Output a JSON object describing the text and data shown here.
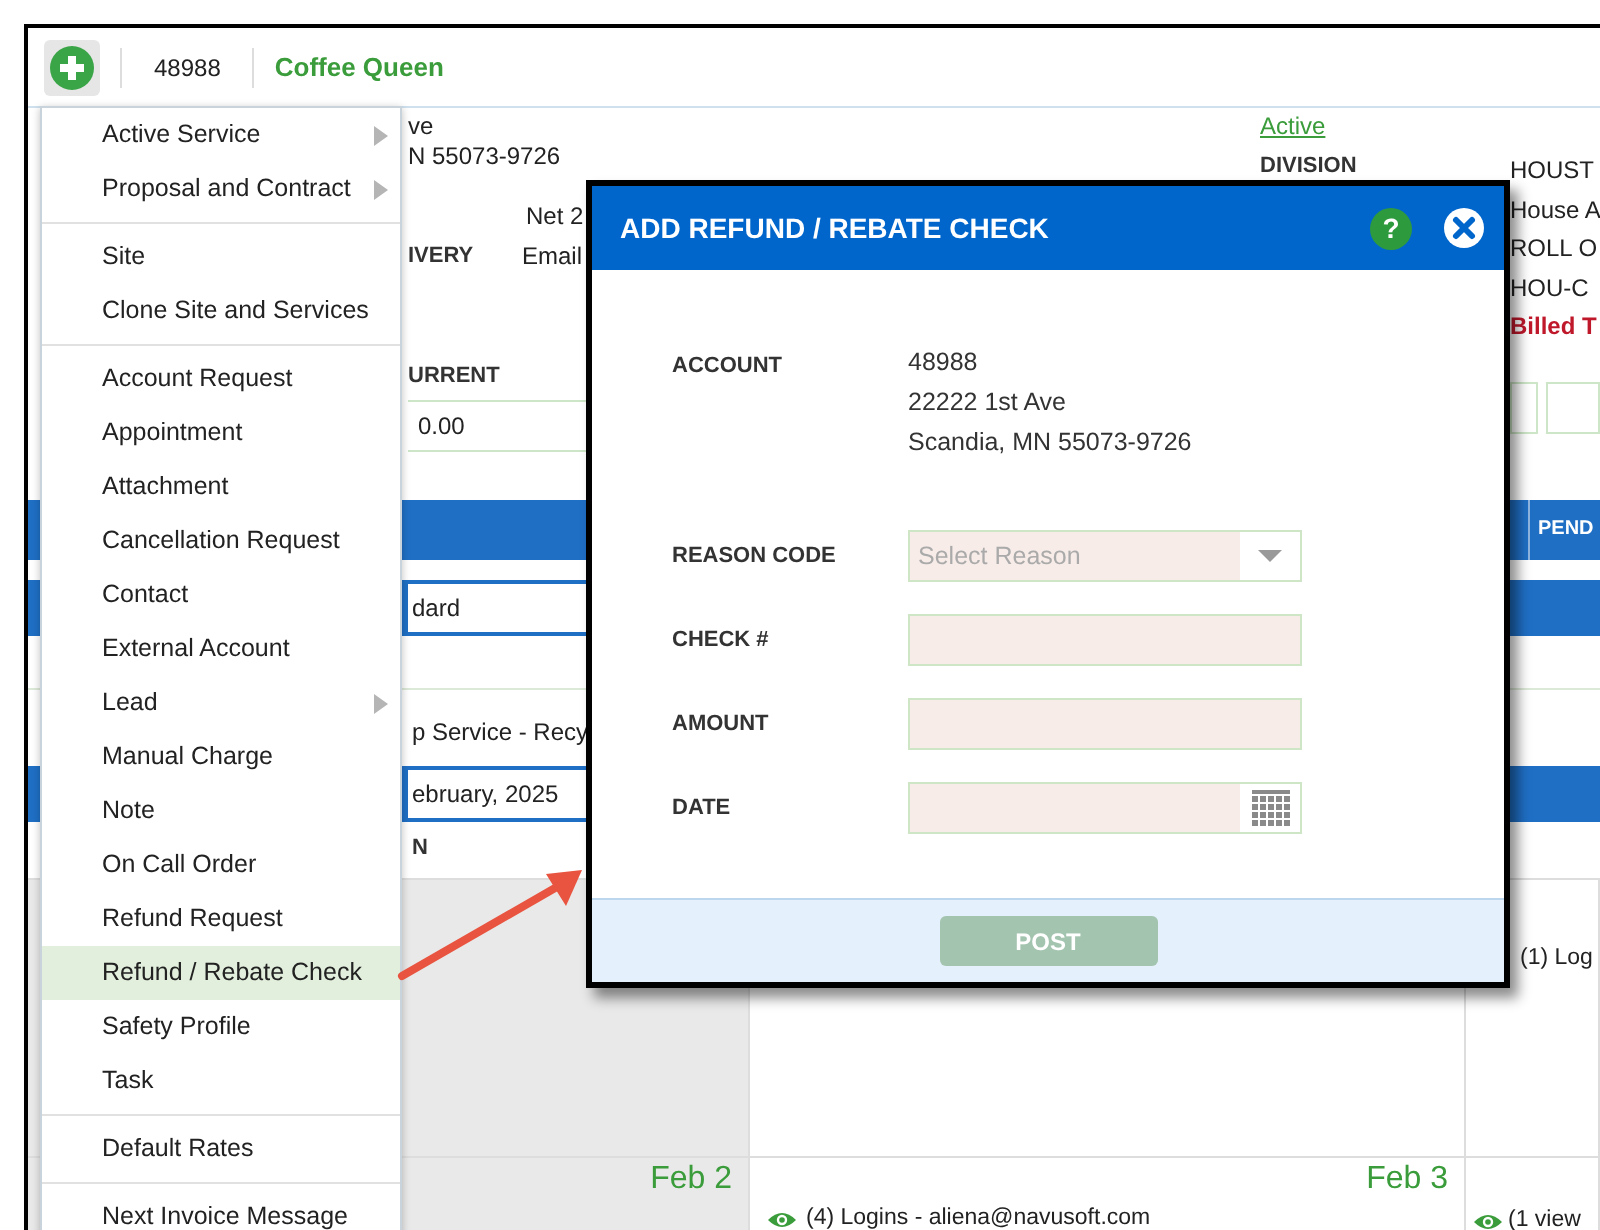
{
  "header": {
    "account_number": "48988",
    "customer_name": "Coffee Queen"
  },
  "account_summary": {
    "address_lines": [
      "ve",
      "N 55073-9726"
    ],
    "terms": "Net 2",
    "delivery": {
      "label": "IVERY",
      "value": "Email"
    },
    "balance": {
      "label": "URRENT",
      "value": "0.00"
    },
    "status": "Active",
    "division": {
      "label": "DIVISION",
      "values": [
        "HOUST",
        "House A",
        "ROLL O",
        "HOU-C"
      ]
    },
    "billing_notice": "Billed T"
  },
  "services_header": {
    "column_label": "PEND"
  },
  "service_rows": [
    {
      "kind": "blue-field",
      "value": "dard"
    },
    {
      "kind": "blank"
    },
    {
      "kind": "text",
      "value": "p Service - Recy"
    },
    {
      "kind": "blue-field",
      "value": "ebruary, 2025"
    },
    {
      "kind": "label",
      "value": "N"
    }
  ],
  "calendar": {
    "weeks": [
      {
        "days": [
          {
            "weekend": true
          },
          {
            "weekend": false
          },
          {
            "weekend": false,
            "events": [
              {
                "text": "(1) Log",
                "eye_icon": false
              }
            ]
          }
        ]
      },
      {
        "days": [
          {
            "date": "Feb 2",
            "weekend": true
          },
          {
            "date": "Feb 3",
            "weekend": false,
            "events": [
              {
                "text": "(4) Logins - aliena@navusoft.com",
                "eye_icon": true
              }
            ]
          },
          {
            "weekend": false,
            "events": [
              {
                "text": "(1 view",
                "eye_icon": true
              }
            ]
          }
        ]
      }
    ]
  },
  "context_menu": {
    "groups": [
      {
        "items": [
          {
            "label": "Active Service",
            "submenu": true,
            "selected": false
          },
          {
            "label": "Proposal and Contract",
            "submenu": true,
            "selected": false
          }
        ]
      },
      {
        "items": [
          {
            "label": "Site",
            "submenu": false,
            "selected": false
          },
          {
            "label": "Clone Site and Services",
            "submenu": false,
            "selected": false
          }
        ]
      },
      {
        "items": [
          {
            "label": "Account Request",
            "submenu": false,
            "selected": false
          },
          {
            "label": "Appointment",
            "submenu": false,
            "selected": false
          },
          {
            "label": "Attachment",
            "submenu": false,
            "selected": false
          },
          {
            "label": "Cancellation Request",
            "submenu": false,
            "selected": false
          },
          {
            "label": "Contact",
            "submenu": false,
            "selected": false
          },
          {
            "label": "External Account",
            "submenu": false,
            "selected": false
          },
          {
            "label": "Lead",
            "submenu": true,
            "selected": false
          },
          {
            "label": "Manual Charge",
            "submenu": false,
            "selected": false
          },
          {
            "label": "Note",
            "submenu": false,
            "selected": false
          },
          {
            "label": "On Call Order",
            "submenu": false,
            "selected": false
          },
          {
            "label": "Refund Request",
            "submenu": false,
            "selected": false
          },
          {
            "label": "Refund / Rebate Check",
            "submenu": false,
            "selected": true
          },
          {
            "label": "Safety Profile",
            "submenu": false,
            "selected": false
          },
          {
            "label": "Task",
            "submenu": false,
            "selected": false
          }
        ]
      },
      {
        "items": [
          {
            "label": "Default Rates",
            "submenu": false,
            "selected": false
          }
        ]
      },
      {
        "items": [
          {
            "label": "Next Invoice Message",
            "submenu": false,
            "selected": false
          }
        ]
      }
    ]
  },
  "dialog": {
    "title": "ADD REFUND / REBATE CHECK",
    "help_label": "?",
    "fields": [
      {
        "kind": "static",
        "label": "ACCOUNT",
        "lines": [
          "48988",
          "22222 1st Ave",
          "Scandia, MN 55073-9726"
        ]
      },
      {
        "kind": "select",
        "label": "REASON CODE",
        "placeholder": "Select Reason"
      },
      {
        "kind": "text",
        "label": "CHECK #"
      },
      {
        "kind": "text",
        "label": "AMOUNT"
      },
      {
        "kind": "date",
        "label": "DATE"
      }
    ],
    "submit": {
      "label": "POST",
      "disabled": true
    }
  }
}
